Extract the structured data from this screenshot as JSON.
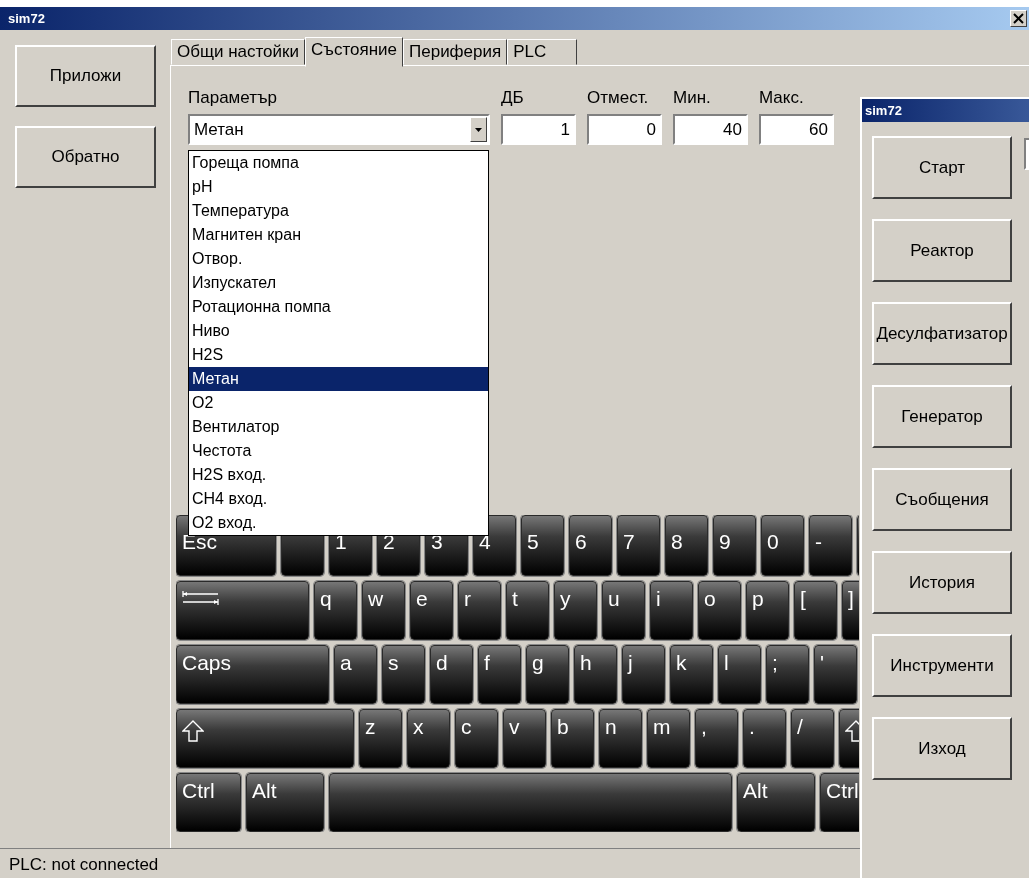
{
  "window": {
    "title": "sim72"
  },
  "side_buttons": [
    "Приложи",
    "Обратно"
  ],
  "tabs": [
    {
      "label": "Общи настойки",
      "selected": false
    },
    {
      "label": "Състояние",
      "selected": true
    },
    {
      "label": "Периферия",
      "selected": false
    },
    {
      "label": "PLC",
      "selected": false
    }
  ],
  "fields": [
    {
      "label": "Параметър",
      "kind": "combo",
      "value": "Метан"
    },
    {
      "label": "ДБ",
      "kind": "number",
      "value": "1"
    },
    {
      "label": "Отмест.",
      "kind": "number",
      "value": "0"
    },
    {
      "label": "Мин.",
      "kind": "number",
      "value": "40"
    },
    {
      "label": "Макс.",
      "kind": "number",
      "value": "60"
    }
  ],
  "dropdown": {
    "items": [
      {
        "label": "Гореща помпа",
        "selected": false
      },
      {
        "label": "pH",
        "selected": false
      },
      {
        "label": "Температура",
        "selected": false
      },
      {
        "label": "Магнитен кран",
        "selected": false
      },
      {
        "label": "Отвор.",
        "selected": false
      },
      {
        "label": "Изпускател",
        "selected": false
      },
      {
        "label": "Ротационна помпа",
        "selected": false
      },
      {
        "label": "Ниво",
        "selected": false
      },
      {
        "label": "H2S",
        "selected": false
      },
      {
        "label": "Метан",
        "selected": true
      },
      {
        "label": "O2",
        "selected": false
      },
      {
        "label": "Вентилатор",
        "selected": false
      },
      {
        "label": "Честота",
        "selected": false
      },
      {
        "label": "H2S вход.",
        "selected": false
      },
      {
        "label": "CH4 вход.",
        "selected": false
      },
      {
        "label": "O2 вход.",
        "selected": false
      }
    ]
  },
  "keyboard": {
    "rows": [
      [
        {
          "kind": "esc",
          "label": "Esc"
        },
        {
          "kind": "char"
        },
        {
          "kind": "char",
          "label": "1"
        },
        {
          "kind": "char",
          "label": "2"
        },
        {
          "kind": "char",
          "label": "3"
        },
        {
          "kind": "char",
          "label": "4"
        },
        {
          "kind": "char",
          "label": "5"
        },
        {
          "kind": "char",
          "label": "6"
        },
        {
          "kind": "char",
          "label": "7"
        },
        {
          "kind": "char",
          "label": "8"
        },
        {
          "kind": "char",
          "label": "9"
        },
        {
          "kind": "char",
          "label": "0"
        },
        {
          "kind": "char",
          "label": "-"
        },
        {
          "kind": "char"
        }
      ],
      [
        {
          "kind": "tab"
        },
        {
          "kind": "char",
          "label": "q"
        },
        {
          "kind": "char",
          "label": "w"
        },
        {
          "kind": "char",
          "label": "e"
        },
        {
          "kind": "char",
          "label": "r"
        },
        {
          "kind": "char",
          "label": "t"
        },
        {
          "kind": "char",
          "label": "y"
        },
        {
          "kind": "char",
          "label": "u"
        },
        {
          "kind": "char",
          "label": "i"
        },
        {
          "kind": "char",
          "label": "o"
        },
        {
          "kind": "char",
          "label": "p"
        },
        {
          "kind": "char",
          "label": "["
        },
        {
          "kind": "char",
          "label": "]"
        }
      ],
      [
        {
          "kind": "caps",
          "label": "Caps"
        },
        {
          "kind": "char",
          "label": "a"
        },
        {
          "kind": "char",
          "label": "s"
        },
        {
          "kind": "char",
          "label": "d"
        },
        {
          "kind": "char",
          "label": "f"
        },
        {
          "kind": "char",
          "label": "g"
        },
        {
          "kind": "char",
          "label": "h"
        },
        {
          "kind": "char",
          "label": "j"
        },
        {
          "kind": "char",
          "label": "k"
        },
        {
          "kind": "char",
          "label": "l"
        },
        {
          "kind": "char",
          "label": ";"
        },
        {
          "kind": "char",
          "label": "'"
        }
      ],
      [
        {
          "kind": "shift"
        },
        {
          "kind": "char",
          "label": "z"
        },
        {
          "kind": "char",
          "label": "x"
        },
        {
          "kind": "char",
          "label": "c"
        },
        {
          "kind": "char",
          "label": "v"
        },
        {
          "kind": "char",
          "label": "b"
        },
        {
          "kind": "char",
          "label": "n"
        },
        {
          "kind": "char",
          "label": "m"
        },
        {
          "kind": "char",
          "label": ","
        },
        {
          "kind": "char",
          "label": "."
        },
        {
          "kind": "char",
          "label": "/"
        },
        {
          "kind": "shift"
        }
      ],
      [
        {
          "kind": "ctrl",
          "label": "Ctrl"
        },
        {
          "kind": "alt",
          "label": "Alt"
        },
        {
          "kind": "space"
        },
        {
          "kind": "alt",
          "label": "Alt"
        },
        {
          "kind": "ctrl",
          "label": "Ctrl"
        }
      ]
    ]
  },
  "dialog": {
    "title": "sim72",
    "buttons": [
      "Старт",
      "Реактор",
      "Десулфатизатор",
      "Генератор",
      "Съобщения",
      "История",
      "Инструменти",
      "Изход"
    ]
  },
  "status_bar": "PLC: not connected"
}
